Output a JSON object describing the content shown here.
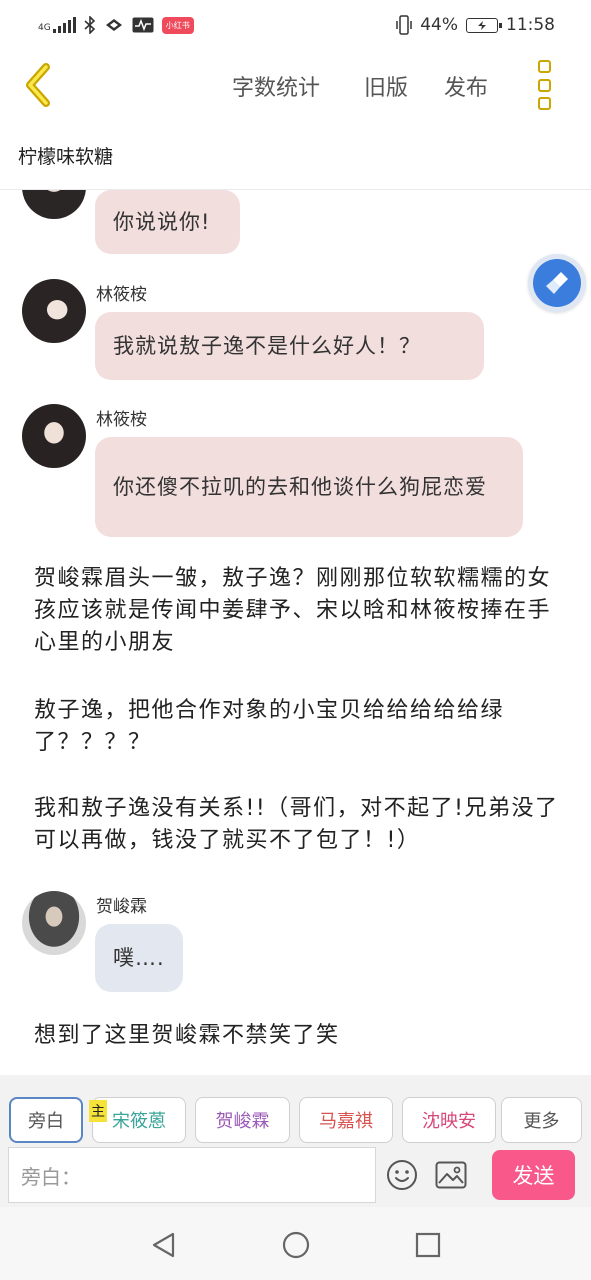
{
  "status_bar": {
    "network": "4G",
    "badge": "小红书",
    "battery": "44%",
    "time": "11:58"
  },
  "topbar": {
    "word_count": "字数统计",
    "old_version": "旧版",
    "publish": "发布"
  },
  "book_title": "柠檬味软糖",
  "chat": {
    "msg1": {
      "text": "你说说你!"
    },
    "msg2": {
      "speaker": "林筱桉",
      "text": "我就说敖子逸不是什么好人！？"
    },
    "msg3": {
      "speaker": "林筱桉",
      "text": "你还傻不拉叽的去和他谈什么狗屁恋爱"
    },
    "narration1": "贺峻霖眉头一皱，敖子逸？刚刚那位软软糯糯的女孩应该就是传闻中姜肆予、宋以晗和林筱桉捧在手心里的小朋友",
    "narration2": "敖子逸，把他合作对象的小宝贝给给给给给绿了？？？？",
    "narration3": "我和敖子逸没有关系!!（哥们，对不起了!兄弟没了可以再做，钱没了就买不了包了！!）",
    "msg4": {
      "speaker": "贺峻霖",
      "text": "噗…."
    },
    "narration4": "想到了这里贺峻霖不禁笑了笑"
  },
  "roles": {
    "main_tag": "主",
    "items": [
      {
        "label": "旁白",
        "color": "#555555"
      },
      {
        "label": "宋筱蒽",
        "color": "#3aa59a"
      },
      {
        "label": "贺峻霖",
        "color": "#9b59b6"
      },
      {
        "label": "马嘉祺",
        "color": "#d9534f"
      },
      {
        "label": "沈映安",
        "color": "#d6487a"
      },
      {
        "label": "更多",
        "color": "#555555"
      }
    ]
  },
  "input": {
    "placeholder": "旁白："
  },
  "send": "发送"
}
